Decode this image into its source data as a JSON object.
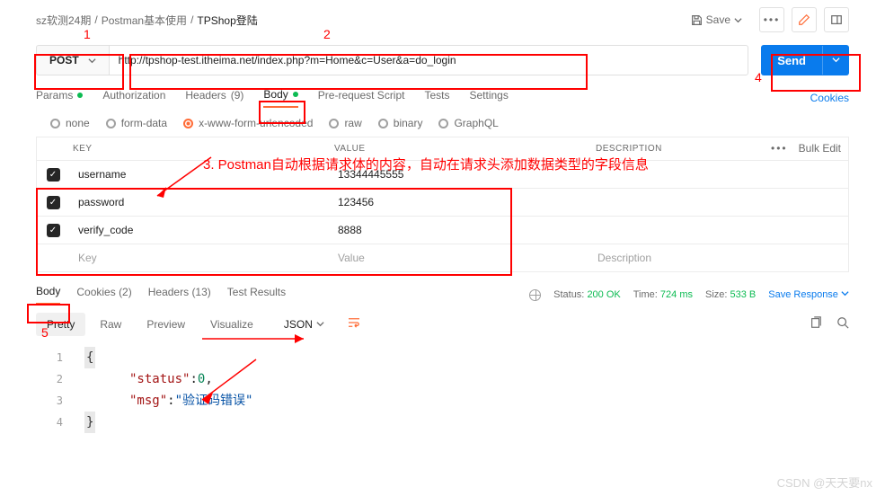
{
  "breadcrumb": {
    "items": [
      "sz软测24期",
      "Postman基本使用",
      "TPShop登陆"
    ]
  },
  "save_label": "Save",
  "method": "POST",
  "url": "http://tpshop-test.itheima.net/index.php?m=Home&c=User&a=do_login",
  "send_label": "Send",
  "req_tabs": {
    "params": "Params",
    "auth": "Authorization",
    "headers": "Headers",
    "headers_count": "(9)",
    "body": "Body",
    "prereq": "Pre-request Script",
    "tests": "Tests",
    "settings": "Settings"
  },
  "cookies_link": "Cookies",
  "body_types": {
    "none": "none",
    "form": "form-data",
    "xwww": "x-www-form-urlencoded",
    "raw": "raw",
    "binary": "binary",
    "graphql": "GraphQL"
  },
  "kv": {
    "head_key": "KEY",
    "head_value": "VALUE",
    "head_desc": "DESCRIPTION",
    "bulk": "Bulk Edit",
    "rows": [
      {
        "key": "username",
        "value": "13344445555"
      },
      {
        "key": "password",
        "value": "123456"
      },
      {
        "key": "verify_code",
        "value": "8888"
      }
    ],
    "ph_key": "Key",
    "ph_value": "Value",
    "ph_desc": "Description"
  },
  "resp_tabs": {
    "body": "Body",
    "cookies": "Cookies",
    "cookies_count": "(2)",
    "headers": "Headers",
    "headers_count": "(13)",
    "tests": "Test Results"
  },
  "status": {
    "label": "Status:",
    "value": "200 OK",
    "time_label": "Time:",
    "time_value": "724 ms",
    "size_label": "Size:",
    "size_value": "533 B",
    "save": "Save Response"
  },
  "view": {
    "pretty": "Pretty",
    "raw": "Raw",
    "preview": "Preview",
    "visualize": "Visualize",
    "fmt": "JSON"
  },
  "code": {
    "l1": "{",
    "l2k": "\"status\"",
    "l2v": "0",
    "l3k": "\"msg\"",
    "l3v": "\"验证码错误\"",
    "l4": "}"
  },
  "annotations": {
    "a1": "1",
    "a2": "2",
    "a3": "3. Postman自动根据请求体的内容，自动在请求头添加数据类型的字段信息",
    "a4": "4",
    "a5": "5"
  },
  "watermark": "CSDN @天天要nx"
}
